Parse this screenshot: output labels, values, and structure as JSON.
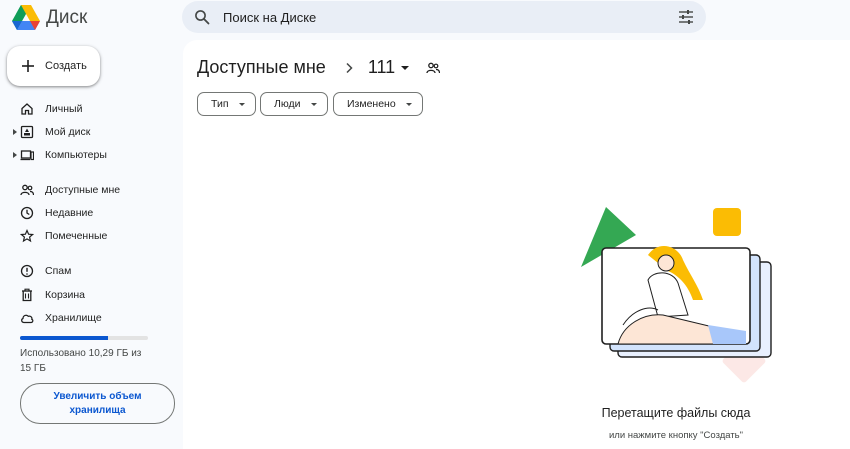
{
  "app": {
    "name": "Диск"
  },
  "search": {
    "placeholder": "Поиск на Диске"
  },
  "sidebar": {
    "create_label": "Создать",
    "items": [
      {
        "label": "Личный",
        "icon": "home-icon"
      },
      {
        "label": "Мой диск",
        "icon": "my-drive-icon"
      },
      {
        "label": "Компьютеры",
        "icon": "computer-icon"
      },
      {
        "label": "Доступные мне",
        "icon": "people-icon"
      },
      {
        "label": "Недавние",
        "icon": "clock-icon"
      },
      {
        "label": "Помеченные",
        "icon": "star-icon"
      },
      {
        "label": "Спам",
        "icon": "spam-icon"
      },
      {
        "label": "Корзина",
        "icon": "trash-icon"
      },
      {
        "label": "Хранилище",
        "icon": "cloud-icon"
      }
    ],
    "storage": {
      "used_fraction": 0.686,
      "text": "Использовано 10,29 ГБ из 15 ГБ",
      "upgrade_label": "Увеличить объем хранилища"
    }
  },
  "main": {
    "breadcrumb": {
      "parent": "Доступные мне",
      "current": "111"
    },
    "filters": [
      "Тип",
      "Люди",
      "Изменено"
    ],
    "empty": {
      "title": "Перетащите файлы сюда",
      "subtitle": "или нажмите кнопку \"Создать\""
    }
  },
  "colors": {
    "accent": "#0b57d0",
    "search_bg": "#e9eef6",
    "page_bg": "#f8fafd"
  }
}
